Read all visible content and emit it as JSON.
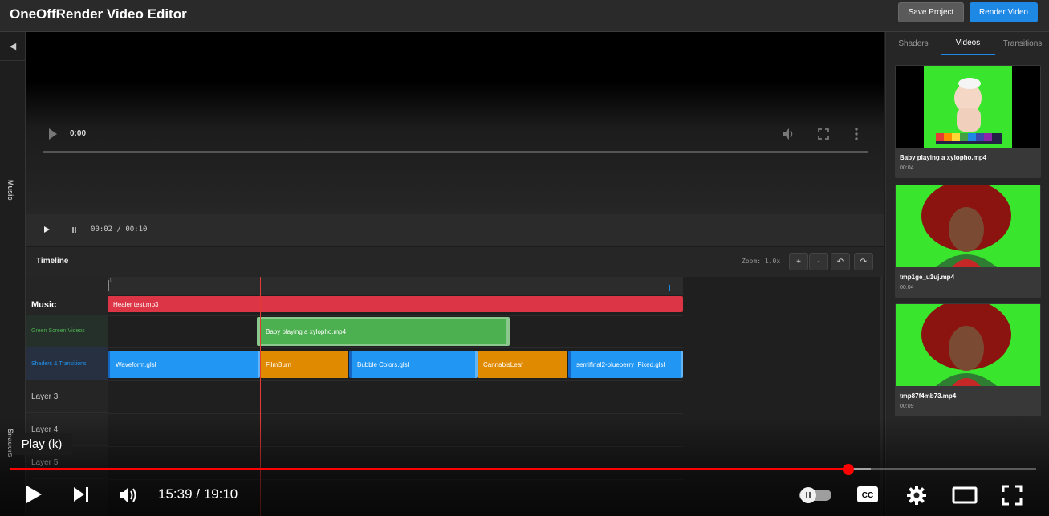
{
  "app": {
    "title": "OneOffRender Video Editor"
  },
  "header": {
    "save_label": "Save Project",
    "render_label": "Render Video"
  },
  "left_sidebar": {
    "collapse_icon": "chevron-left-icon",
    "music_label": "Music",
    "shaders_label": "Shaders"
  },
  "preview": {
    "current_time": "0:00"
  },
  "playback": {
    "time_display": "00:02 / 00:10"
  },
  "timeline": {
    "title": "Timeline",
    "zoom_label": "Zoom: 1.0x",
    "zoom_in": "+",
    "zoom_out": "-",
    "undo": "↶",
    "redo": "↷",
    "ruler_zero": "0",
    "tracks": [
      {
        "label": "Music",
        "color": "#ffffff"
      },
      {
        "label": "Green Screen Videos",
        "color": "#4caf50"
      },
      {
        "label": "Shaders & Transitions",
        "color": "#2196f3"
      },
      {
        "label": "Layer 3",
        "color": "#cccccc"
      },
      {
        "label": "Layer 4",
        "color": "#cccccc"
      },
      {
        "label": "Layer 5",
        "color": "#cccccc"
      }
    ],
    "clips": {
      "music": "Healer test.mp3",
      "green": "Baby playing a xylopho.mp4",
      "shader1": "Waveform.glsl",
      "shader2": "FilmBurn",
      "shader3": "Bubble Colors.glsl",
      "shader4": "CannabisLeaf",
      "shader5": "semifinal2-blueberry_Fixed.glsl"
    },
    "colors": {
      "music": "#dc3545",
      "green": "#4caf50",
      "shader": "#2196f3",
      "transition": "#e08a00"
    }
  },
  "right_panel": {
    "tabs": [
      "Shaders",
      "Videos",
      "Transitions"
    ],
    "active_tab": "Videos",
    "videos": [
      {
        "name": "Baby playing a xylopho.mp4",
        "duration": "00:04"
      },
      {
        "name": "tmp1ge_u1uj.mp4",
        "duration": "00:04"
      },
      {
        "name": "tmp87f4mb73.mp4",
        "duration": "00:09"
      }
    ]
  },
  "youtube": {
    "tooltip": "Play (k)",
    "time": "15:39 / 19:10",
    "progress_fraction": 0.817,
    "buffer_fraction": 0.839,
    "accent": "#ff0000"
  }
}
